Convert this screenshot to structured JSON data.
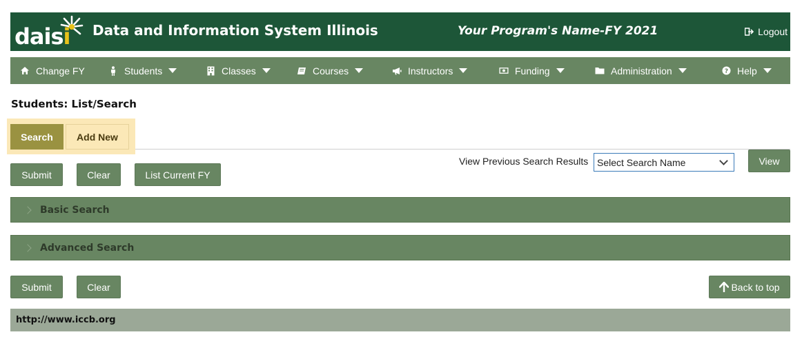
{
  "header": {
    "logo_text": "dais",
    "logo_i": "i",
    "title": "Data and Information System Illinois",
    "program_name": "Your Program's Name-FY 2021",
    "logout_label": "Logout"
  },
  "nav": {
    "items": [
      {
        "label": "Change FY",
        "icon": "home-icon",
        "dropdown": false
      },
      {
        "label": "Students",
        "icon": "student-icon",
        "dropdown": true
      },
      {
        "label": "Classes",
        "icon": "building-icon",
        "dropdown": true
      },
      {
        "label": "Courses",
        "icon": "book-icon",
        "dropdown": true
      },
      {
        "label": "Instructors",
        "icon": "megaphone-icon",
        "dropdown": true
      },
      {
        "label": "Funding",
        "icon": "money-icon",
        "dropdown": true
      },
      {
        "label": "Administration",
        "icon": "folder-icon",
        "dropdown": true
      },
      {
        "label": "Help",
        "icon": "question-icon",
        "dropdown": true
      }
    ]
  },
  "page": {
    "title": "Students: List/Search"
  },
  "tabs": {
    "search": "Search",
    "add_new": "Add New"
  },
  "actions_top": {
    "submit": "Submit",
    "clear": "Clear",
    "list_current": "List Current FY"
  },
  "previous_search": {
    "label": "View Previous Search Results",
    "select_value": "Select Search Name",
    "view_button": "View"
  },
  "panels": {
    "basic": "Basic Search",
    "advanced": "Advanced Search"
  },
  "actions_bottom": {
    "submit": "Submit",
    "clear": "Clear",
    "back_to_top": "Back to top"
  },
  "footer": {
    "link": "http://www.iccb.org"
  },
  "colors": {
    "header_bg": "#1d5638",
    "nav_bg": "#688662",
    "active_tab": "#9a9241",
    "tab_highlight": "#fbe8b7",
    "footer_bg": "#9ba897",
    "logo_accent": "#e8c21a"
  }
}
